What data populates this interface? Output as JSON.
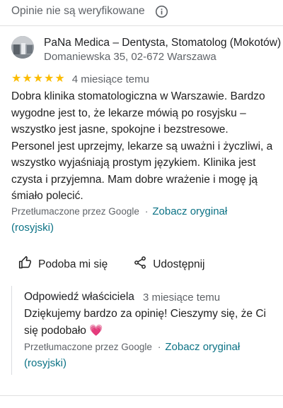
{
  "notice": {
    "text": "Opinie nie są weryfikowane",
    "icon": "info-icon"
  },
  "business": {
    "name": "PaNa Medica – Dentysta, Stomatolog (Mokotów)",
    "address": "Domaniewska 35, 02-672 Warszawa"
  },
  "review": {
    "stars": 5,
    "star_glyph": "★",
    "time": "4 miesiące temu",
    "text": "Dobra klinika stomatologiczna w Warszawie. Bardzo wygodne jest to, że lekarze mówią po rosyjsku – wszystko jest jasne, spokojne i bezstresowe. Personel jest uprzejmy, lekarze są uważni i życzliwi, a wszystko wyjaśniają prostym językiem. Klinika jest czysta i przyjemna. Mam dobre wrażenie i mogę ją śmiało polecić.",
    "translated_by": "Przetłumaczone przez Google",
    "separator": "·",
    "see_original": "Zobacz oryginał (rosyjski)"
  },
  "actions": {
    "like_label": "Podoba mi się",
    "share_label": "Udostępnij"
  },
  "owner_reply": {
    "title": "Odpowiedź właściciela",
    "time": "3 miesiące temu",
    "text": "Dziękujemy bardzo za opinię! Cieszymy się, że Ci się podobało",
    "emoji": "💗",
    "translated_by": "Przetłumaczone przez Google",
    "separator": "·",
    "see_original": "Zobacz oryginał (rosyjski)"
  },
  "colors": {
    "star": "#fbbc04",
    "link": "#0b7285",
    "secondary_text": "#5f6368",
    "heart": "#e23d78"
  }
}
